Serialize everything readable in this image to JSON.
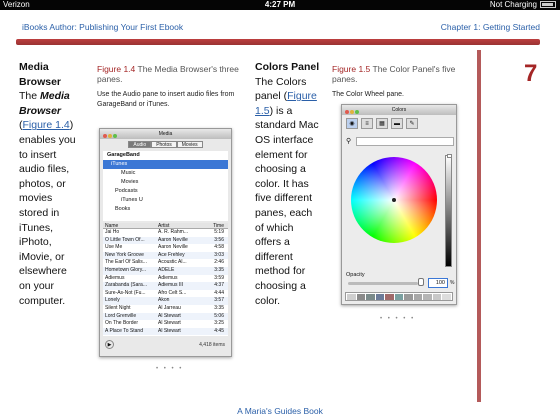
{
  "status": {
    "carrier": "Verizon",
    "time": "4:27 PM",
    "battery": "Not Charging"
  },
  "header": {
    "left": "iBooks Author: Publishing Your First Ebook",
    "right": "Chapter 1: Getting Started"
  },
  "chapter_number": "7",
  "col1": {
    "heading": "Media Browser",
    "the": "The",
    "term": "Media Browser",
    "link": "Figure 1.4",
    "body": "enables you to insert audio files, photos, or movies stored in iTunes, iPhoto, iMovie, or elsewhere on your computer."
  },
  "figure1": {
    "num": "Figure 1.4",
    "caption": "The Media Browser's three panes.",
    "desc": "Use the Audio pane to insert audio files from GarageBand or iTunes.",
    "window_title": "Media",
    "tabs": [
      "Audio",
      "Photos",
      "Movies"
    ],
    "tree": [
      "GarageBand",
      "iTunes",
      "Music",
      "Movies",
      "Podcasts",
      "iTunes U",
      "Books"
    ],
    "columns": [
      "Name",
      "Artist",
      "Time"
    ],
    "rows": [
      [
        "Jai Ho",
        "A. R. Rahm...",
        "5:19"
      ],
      [
        "O Little Town Of...",
        "Aaron Neville",
        "3:56"
      ],
      [
        "Use Me",
        "Aaron Neville",
        "4:58"
      ],
      [
        "New York Groove",
        "Ace Frehley",
        "3:03"
      ],
      [
        "The Earl Of Salis...",
        "Acoustic Al...",
        "2:46"
      ],
      [
        "Hometown Glory...",
        "ADELE",
        "3:35"
      ],
      [
        "Adiemus",
        "Adiemus",
        "3:59"
      ],
      [
        "Zarabanda (Sara...",
        "Adiemus III",
        "4:37"
      ],
      [
        "Sure-As-Not (Fu...",
        "Afro Celt S...",
        "4:44"
      ],
      [
        "Lonely",
        "Akon",
        "3:57"
      ],
      [
        "Silent Night",
        "Al Jarreau",
        "3:35"
      ],
      [
        "Lord Grenville",
        "Al Stewart",
        "5:06"
      ],
      [
        "On The Border",
        "Al Stewart",
        "3:25"
      ],
      [
        "A Place To Stand",
        "Al Stewart",
        "4:45"
      ]
    ],
    "count": "4,418 items"
  },
  "col3": {
    "heading": "Colors Panel",
    "body1": "The Colors panel (",
    "link": "Figure 1.5",
    "body2": ") is a standard Mac OS interface element for choosing a color. It has five different panes, each of which offers a different method for choosing a color."
  },
  "figure2": {
    "num": "Figure 1.5",
    "caption": "The Color Panel's five panes.",
    "desc": "The Color Wheel pane.",
    "window_title": "Colors",
    "opacity_label": "Opacity",
    "opacity_value": "100",
    "opacity_unit": "%",
    "swatches": [
      "#cfcfcf",
      "#8a8a8a",
      "#7a8a8a",
      "#6b7b99",
      "#a06a6a",
      "#7aa0a0",
      "#999999",
      "#a8a8a8",
      "#b5b5b5",
      "#c8c8c8",
      "#dddddd"
    ]
  },
  "page_dots": "• • • •",
  "page_dots2": "• • • • •",
  "footer": "A Maria's Guides Book"
}
